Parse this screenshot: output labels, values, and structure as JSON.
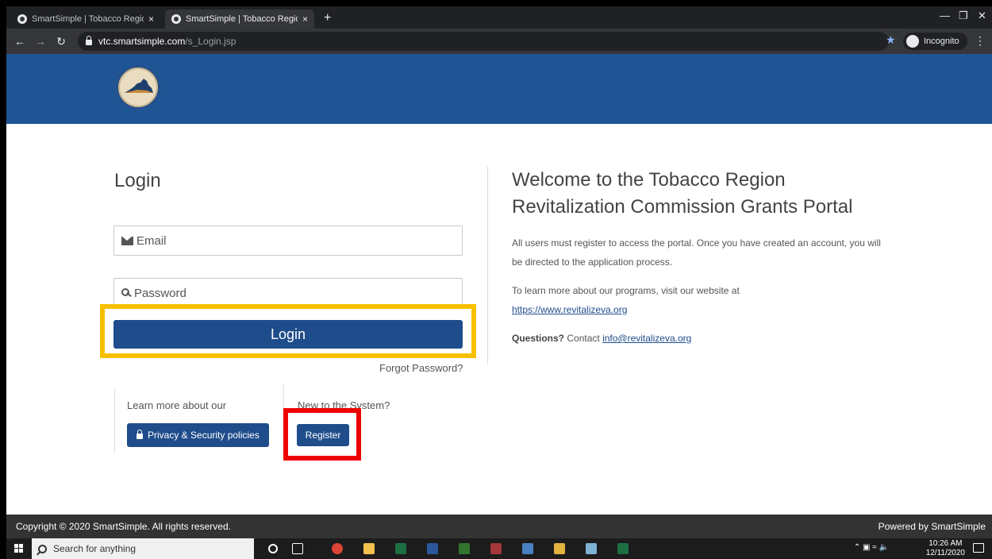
{
  "browser": {
    "tabs": [
      {
        "title": "SmartSimple | Tobacco Region Re",
        "active": false
      },
      {
        "title": "SmartSimple | Tobacco Region Re",
        "active": true
      }
    ],
    "new_tab": "+",
    "close": "×",
    "url_host": "vtc.smartsimple.com",
    "url_path": "/s_Login.jsp",
    "incognito_label": "Incognito"
  },
  "login": {
    "title": "Login",
    "email_placeholder": "Email",
    "password_placeholder": "Password",
    "login_button": "Login",
    "forgot_password": "Forgot Password?",
    "learn_more": "Learn more about our",
    "privacy_button": "Privacy & Security policies",
    "new_to_system": "New to the System?",
    "register_button": "Register"
  },
  "welcome": {
    "heading": "Welcome to the Tobacco Region Revitalization Commission Grants Portal",
    "para1": "All users must register to access the portal. Once you have created an account, you will be directed to the application process.",
    "para2_text": "To learn more about our programs, visit our website at",
    "website_link": "https://www.revitalizeva.org",
    "questions_label": "Questions?",
    "contact_text": "Contact",
    "email_link": "info@revitalizeva.org"
  },
  "footer": {
    "copyright": "Copyright © 2020 SmartSimple. All rights reserved.",
    "powered_by": "Powered by SmartSimple"
  },
  "taskbar": {
    "search_placeholder": "Search for anything",
    "time": "10:26 AM",
    "date": "12/11/2020"
  },
  "colors": {
    "header_blue": "#1f5595",
    "button_blue": "#1f4d8c",
    "highlight_yellow": "#f8bf00",
    "highlight_red": "#ee0000"
  }
}
